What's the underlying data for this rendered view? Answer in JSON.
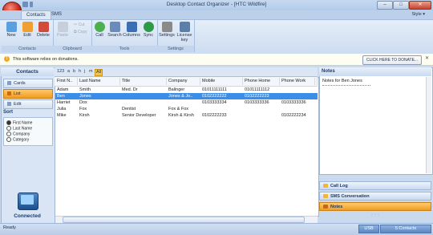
{
  "window": {
    "title": "Desktop Contact Organizer - [HTC Wildfire]",
    "minimize": "–",
    "maximize": "□",
    "close": "✕"
  },
  "ribbon": {
    "tabs": [
      "Contacts",
      "SMS"
    ],
    "style_label": "Style ▾",
    "groups": {
      "contacts": {
        "label": "Contacts",
        "new": "New",
        "edit": "Edit",
        "delete": "Delete"
      },
      "clipboard": {
        "label": "Clipboard",
        "paste": "Paste",
        "cut": "Cut",
        "copy": "Copy"
      },
      "tools": {
        "label": "Tools",
        "call": "Call",
        "search": "Search",
        "columns": "Columns",
        "sync": "Sync"
      },
      "settings": {
        "label": "Settings",
        "settings": "Settings",
        "license": "License key"
      }
    },
    "icon_colors": {
      "new": "#5aa0e0",
      "edit": "#f0a030",
      "delete": "#d24a3a",
      "paste": "#c6cfdb",
      "call": "#4caf50",
      "search": "#6b8cba",
      "columns": "#3b6fb5",
      "sync": "#2e9a46",
      "settings": "#8a8a8a",
      "license": "#5b7fa8"
    }
  },
  "infobar": {
    "icon": "!",
    "message": "This software relies on donations.",
    "donate_button": "CLICK HERE TO DONATE...",
    "close": "✕"
  },
  "left_pane": {
    "title": "Contacts",
    "nav": [
      "Cards",
      "List",
      "Edit"
    ],
    "sort_title": "Sort",
    "sort_options": [
      "First Name",
      "Last Name",
      "Company",
      "Category"
    ],
    "sort_selected_index": 0,
    "connection_status": "Connected"
  },
  "letter_bar": [
    "123",
    "a",
    "b",
    "h",
    "j",
    "m",
    "All"
  ],
  "table": {
    "columns": [
      "First N..",
      "Last Name",
      "Title",
      "Company",
      "Mobile",
      "Phone Home",
      "Phone Work",
      "F"
    ],
    "rows": [
      [
        "Adam",
        "Smith",
        "Med. Dr",
        "Balinger",
        "01011111111",
        "01011111112",
        "",
        ""
      ],
      [
        "Ben",
        "Jones",
        "",
        "Jones & Jo..",
        "0102222222",
        "0102222223",
        "",
        ""
      ],
      [
        "Harriet",
        "Dox",
        "",
        "",
        "0103333334",
        "0103333336",
        "0103333336",
        ""
      ],
      [
        "Julia",
        "Fox",
        "Dentist",
        "Fox & Fox",
        "",
        "",
        "",
        ""
      ],
      [
        "Mike",
        "Kirsh",
        "Senior Developer",
        "Kirsh & Kirsh",
        "0102222233",
        "",
        "0102222234",
        ""
      ]
    ],
    "selected_row": 1
  },
  "notes": {
    "title": "Notes",
    "text": "Notes for Ben Jones"
  },
  "side_buttons": [
    "Call Log",
    "SMS Conversation",
    "Notes"
  ],
  "status": {
    "ready": "Ready",
    "connection": "USB",
    "count": "5 Contacts"
  }
}
